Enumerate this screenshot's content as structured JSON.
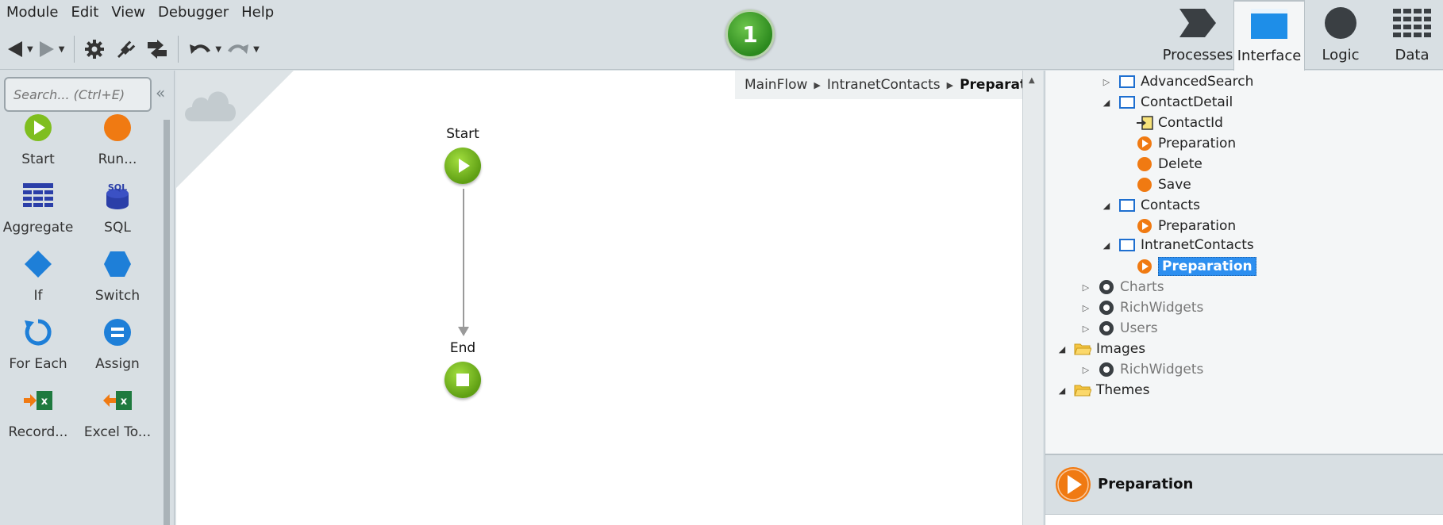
{
  "menu": [
    "Module",
    "Edit",
    "View",
    "Debugger",
    "Help"
  ],
  "toolbar": {
    "icons": [
      "back-arrow-icon",
      "forward-arrow-icon",
      "settings-gear-icon",
      "plug-icon",
      "publish-icon",
      "undo-icon",
      "redo-icon"
    ]
  },
  "counter_badge": "1",
  "tabs": [
    {
      "label": "Processes",
      "icon": "processes-chevron-icon",
      "active": false
    },
    {
      "label": "Interface",
      "icon": "interface-window-icon",
      "active": true
    },
    {
      "label": "Logic",
      "icon": "logic-circle-icon",
      "active": false
    },
    {
      "label": "Data",
      "icon": "data-grid-icon",
      "active": false
    }
  ],
  "palette": {
    "search_placeholder": "Search... (Ctrl+E)",
    "tools": [
      {
        "label": "Start",
        "icon": "start-icon"
      },
      {
        "label": "Run...",
        "icon": "run-server-action-icon"
      },
      {
        "label": "Aggregate",
        "icon": "aggregate-icon"
      },
      {
        "label": "SQL",
        "icon": "sql-icon"
      },
      {
        "label": "If",
        "icon": "if-diamond-icon"
      },
      {
        "label": "Switch",
        "icon": "switch-hexagon-icon"
      },
      {
        "label": "For Each",
        "icon": "for-each-loop-icon"
      },
      {
        "label": "Assign",
        "icon": "assign-icon"
      },
      {
        "label": "Record...",
        "icon": "record-list-to-excel-icon"
      },
      {
        "label": "Excel To...",
        "icon": "excel-to-record-list-icon"
      }
    ]
  },
  "canvas": {
    "breadcrumb": [
      "MainFlow",
      "IntranetContacts",
      "Preparation"
    ],
    "nodes": {
      "start_label": "Start",
      "end_label": "End"
    }
  },
  "tree": {
    "rows": [
      {
        "label": "AdvancedSearch",
        "icon": "screen-icon",
        "expander": "collapsed"
      },
      {
        "label": "ContactDetail",
        "icon": "screen-icon",
        "expander": "expanded"
      },
      {
        "label": "ContactId",
        "icon": "input-parameter-icon",
        "expander": "none"
      },
      {
        "label": "Preparation",
        "icon": "preparation-icon",
        "expander": "none"
      },
      {
        "label": "Delete",
        "icon": "screen-action-icon",
        "expander": "none"
      },
      {
        "label": "Save",
        "icon": "screen-action-icon",
        "expander": "none"
      },
      {
        "label": "Contacts",
        "icon": "screen-icon",
        "expander": "expanded"
      },
      {
        "label": "Preparation",
        "icon": "preparation-icon",
        "expander": "none"
      },
      {
        "label": "IntranetContacts",
        "icon": "screen-icon",
        "expander": "expanded"
      },
      {
        "label": "Preparation",
        "icon": "preparation-icon",
        "expander": "none",
        "selected": true
      },
      {
        "label": "Charts",
        "icon": "module-reference-icon",
        "expander": "collapsed"
      },
      {
        "label": "RichWidgets",
        "icon": "module-reference-icon",
        "expander": "collapsed"
      },
      {
        "label": "Users",
        "icon": "module-reference-icon",
        "expander": "collapsed"
      },
      {
        "label": "Images",
        "icon": "folder-icon",
        "expander": "expanded"
      },
      {
        "label": "RichWidgets",
        "icon": "module-reference-icon",
        "expander": "collapsed"
      },
      {
        "label": "Themes",
        "icon": "folder-icon",
        "expander": "expanded"
      }
    ]
  },
  "details": {
    "title": "Preparation",
    "icon": "preparation-icon"
  },
  "colors": {
    "accent_green": "#5f9f14",
    "selection_blue": "#2d8ff0",
    "tab_blue": "#1e8ee8",
    "action_orange": "#f07a12"
  }
}
